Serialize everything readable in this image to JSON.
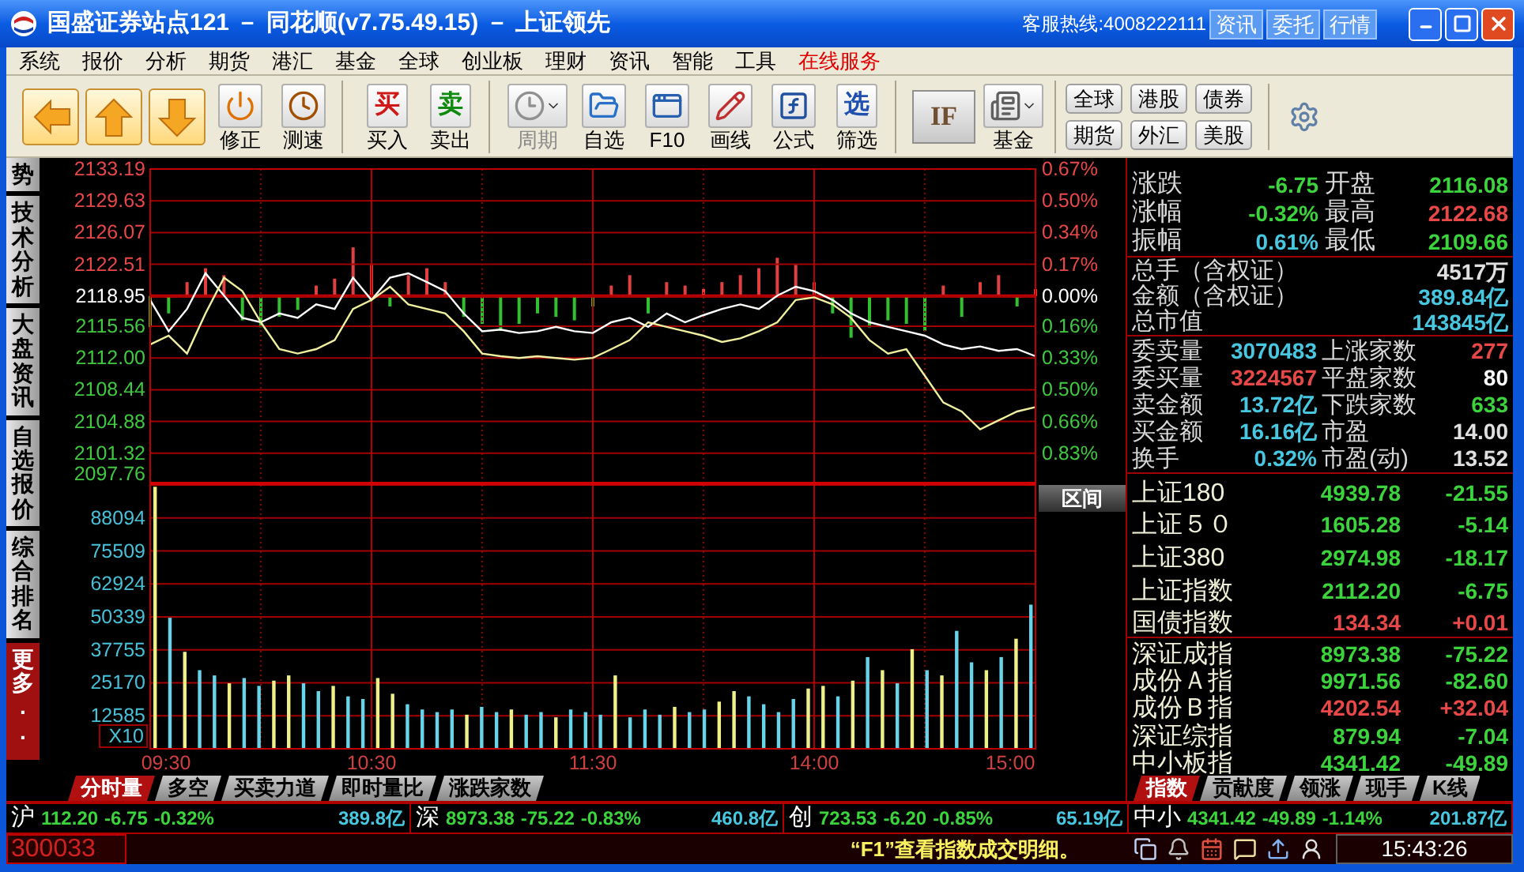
{
  "window": {
    "title": "国盛证券站点121 － 同花顺(v7.75.49.15) － 上证领先",
    "hotline": "客服热线:4008222111",
    "title_buttons": [
      "资讯",
      "委托",
      "行情"
    ]
  },
  "menu": [
    {
      "label": "系统",
      "kind": "normal"
    },
    {
      "label": "报价",
      "kind": "normal"
    },
    {
      "label": "分析",
      "kind": "normal"
    },
    {
      "label": "期货",
      "kind": "normal"
    },
    {
      "label": "港汇",
      "kind": "normal"
    },
    {
      "label": "基金",
      "kind": "normal"
    },
    {
      "label": "全球",
      "kind": "normal"
    },
    {
      "label": "创业板",
      "kind": "normal"
    },
    {
      "label": "理财",
      "kind": "normal"
    },
    {
      "label": "资讯",
      "kind": "normal"
    },
    {
      "label": "智能",
      "kind": "normal"
    },
    {
      "label": "工具",
      "kind": "normal"
    },
    {
      "label": "在线服务",
      "kind": "highlight"
    }
  ],
  "toolbar": {
    "groups": [
      {
        "items": [
          {
            "kind": "arrow"
          },
          {
            "kind": "arrow"
          },
          {
            "kind": "arrow"
          },
          {
            "kind": "tool",
            "label": "修正",
            "disabled": false,
            "dropdown": false
          },
          {
            "kind": "tool",
            "label": "测速",
            "disabled": false,
            "dropdown": false
          }
        ]
      },
      {
        "items": [
          {
            "kind": "glyph",
            "icon_text": "买",
            "color": "#d01818",
            "label": "买入",
            "disabled": false
          },
          {
            "kind": "glyph",
            "icon_text": "卖",
            "color": "#108a10",
            "label": "卖出",
            "disabled": false
          }
        ]
      },
      {
        "items": [
          {
            "kind": "tool",
            "label": "周期",
            "disabled": true,
            "dropdown": true
          },
          {
            "kind": "tool",
            "label": "自选",
            "disabled": false,
            "dropdown": false
          },
          {
            "kind": "tool",
            "label": "F10",
            "disabled": false,
            "dropdown": false
          },
          {
            "kind": "tool",
            "label": "画线",
            "disabled": false,
            "dropdown": false
          },
          {
            "kind": "tool",
            "label": "公式",
            "disabled": false,
            "dropdown": false
          },
          {
            "kind": "glyph",
            "icon_text": "选",
            "color": "#2050b0",
            "label": "筛选",
            "disabled": false
          }
        ]
      },
      {
        "items": [
          {
            "kind": "logo",
            "icon_text": "IF"
          },
          {
            "kind": "tool",
            "label": "基金",
            "disabled": false,
            "dropdown": true
          }
        ]
      }
    ],
    "quick_buttons": [
      "全球",
      "港股",
      "债券",
      "期货",
      "外汇",
      "美股"
    ]
  },
  "side_tabs": [
    {
      "label": "势",
      "kind": "tab"
    },
    {
      "label": "技术分析",
      "kind": "tab"
    },
    {
      "label": "大盘资讯",
      "kind": "tab"
    },
    {
      "label": "自选报价",
      "kind": "tab"
    },
    {
      "label": "综合排名",
      "kind": "tab"
    },
    {
      "label": "更多..",
      "kind": "more"
    }
  ],
  "chart": {
    "price": {
      "right_axis": [
        {
          "text": "0.67%",
          "color": "#e84848"
        },
        {
          "text": "0.50%",
          "color": "#e84848"
        },
        {
          "text": "0.34%",
          "color": "#e84848"
        },
        {
          "text": "0.17%",
          "color": "#e84848"
        },
        {
          "text": "0.00%",
          "color": "#ffffff"
        },
        {
          "text": "0.16%",
          "color": "#40c840"
        },
        {
          "text": "0.33%",
          "color": "#40c840"
        },
        {
          "text": "0.50%",
          "color": "#40c840"
        },
        {
          "text": "0.66%",
          "color": "#40c840"
        },
        {
          "text": "0.83%",
          "color": "#40c840"
        }
      ],
      "chart_data": {
        "type": "line",
        "grid": true,
        "ylim": [
          2097.76,
          2133.19
        ],
        "yticks": [
          {
            "value": 2133.19,
            "label": "2133.19"
          },
          {
            "value": 2129.63,
            "label": "2129.63"
          },
          {
            "value": 2126.07,
            "label": "2126.07"
          },
          {
            "value": 2122.51,
            "label": "2122.51"
          },
          {
            "value": 2118.95,
            "label": "2118.95"
          },
          {
            "value": 2115.56,
            "label": "2115.56"
          },
          {
            "value": 2112.0,
            "label": "2112.00"
          },
          {
            "value": 2108.44,
            "label": "2108.44"
          },
          {
            "value": 2104.88,
            "label": "2104.88"
          },
          {
            "value": 2101.32,
            "label": "2101.32"
          },
          {
            "value": 2097.76,
            "label": "2097.76"
          }
        ],
        "series": [
          {
            "color": "#ffffff",
            "values": [
              2118.5,
              2115.0,
              2117.5,
              2121.5,
              2119.0,
              2116.5,
              2116.0,
              2117.0,
              2116.5,
              2118.0,
              2117.5,
              2121.0,
              2118.5,
              2121.0,
              2121.5,
              2120.5,
              2119.5,
              2117.0,
              2115.0,
              2115.2,
              2114.8,
              2115.0,
              2115.5,
              2115.0,
              2114.8,
              2116.0,
              2116.5,
              2115.5,
              2117.0,
              2116.0,
              2116.8,
              2117.5,
              2118.0,
              2117.5,
              2119.0,
              2120.0,
              2119.5,
              2118.5,
              2117.0,
              2116.0,
              2115.5,
              2115.0,
              2114.5,
              2113.5,
              2113.0,
              2113.3,
              2112.8,
              2113.0,
              2112.2
            ]
          },
          {
            "color": "#f0f0a0",
            "values": [
              2113.5,
              2114.5,
              2112.5,
              2117.0,
              2121.0,
              2119.5,
              2116.0,
              2113.0,
              2112.5,
              2113.0,
              2114.0,
              2117.5,
              2118.5,
              2120.0,
              2118.0,
              2117.5,
              2117.0,
              2115.0,
              2112.5,
              2112.2,
              2112.0,
              2112.2,
              2112.0,
              2111.8,
              2112.0,
              2113.0,
              2114.0,
              2116.0,
              2115.5,
              2115.0,
              2114.5,
              2113.8,
              2114.2,
              2115.0,
              2116.0,
              2118.5,
              2118.8,
              2118.0,
              2116.5,
              2114.0,
              2112.5,
              2113.0,
              2110.0,
              2107.0,
              2106.0,
              2104.0,
              2105.0,
              2106.0,
              2106.5
            ]
          }
        ]
      }
    },
    "range_button": "区间",
    "volume": {
      "multiplier": "X10",
      "chart_data": {
        "type": "bar",
        "grid": true,
        "ylim": [
          0,
          100679
        ],
        "yticks": [
          12585,
          25170,
          37755,
          50339,
          62924,
          75509,
          88094
        ],
        "series": [
          {
            "color": "#f0f088",
            "values": [
              100000,
              null,
              37000,
              null,
              null,
              25000,
              null,
              null,
              26000,
              28000,
              null,
              null,
              24000,
              null,
              null,
              27000,
              21000,
              null,
              null,
              null,
              null,
              13000,
              null,
              null,
              15000,
              null,
              null,
              12000,
              null,
              null,
              null,
              28000,
              null,
              null,
              null,
              16000,
              null,
              null,
              18000,
              22000,
              null,
              null,
              null,
              null,
              23000,
              24000,
              null,
              26000,
              null,
              30000,
              null,
              38000,
              null,
              28000,
              null,
              null,
              30000,
              null,
              42000,
              null
            ]
          },
          {
            "color": "#68d4ea",
            "values": [
              null,
              50000,
              null,
              30000,
              28000,
              null,
              27000,
              24000,
              null,
              null,
              25000,
              22000,
              null,
              20000,
              19000,
              null,
              null,
              17000,
              15000,
              14000,
              15000,
              null,
              16000,
              14000,
              null,
              13000,
              14000,
              null,
              15000,
              14000,
              13000,
              null,
              12000,
              15000,
              13000,
              null,
              14000,
              15000,
              null,
              null,
              20000,
              17000,
              14000,
              19000,
              null,
              null,
              20000,
              null,
              35000,
              null,
              25000,
              null,
              30000,
              null,
              45000,
              33000,
              null,
              35000,
              null,
              55000
            ]
          }
        ]
      }
    },
    "time_axis": [
      "09:30",
      "10:30",
      "11:30",
      "14:00",
      "15:00"
    ],
    "tabs": [
      {
        "label": "分时量",
        "selected": true
      },
      {
        "label": "多空",
        "selected": false
      },
      {
        "label": "买卖力道",
        "selected": false
      },
      {
        "label": "即时量比",
        "selected": false
      },
      {
        "label": "涨跌家数",
        "selected": false
      }
    ]
  },
  "quote": [
    {
      "label": "涨跌",
      "value": "-6.75",
      "color": "#3cd43c"
    },
    {
      "label": "开盘",
      "value": "2116.08",
      "color": "#3cd43c"
    },
    {
      "label": "涨幅",
      "value": "-0.32%",
      "color": "#3cd43c"
    },
    {
      "label": "最高",
      "value": "2122.68",
      "color": "#e84848"
    },
    {
      "label": "振幅",
      "value": "0.61%",
      "color": "#48c8e0"
    },
    {
      "label": "最低",
      "value": "2109.66",
      "color": "#3cd43c"
    }
  ],
  "totals": [
    {
      "label": "总手（含权证）",
      "value": "4517万",
      "color": "#e0e0e0"
    },
    {
      "label": "金额（含权证）",
      "value": "389.84亿",
      "color": "#48c8e0"
    },
    {
      "label": "总市值",
      "value": "143845亿",
      "color": "#48c8e0"
    }
  ],
  "market_stats": [
    {
      "label": "委卖量",
      "value": "3070483",
      "color": "#48c8e0"
    },
    {
      "label": "上涨家数",
      "value": "277",
      "color": "#e84848"
    },
    {
      "label": "委买量",
      "value": "3224567",
      "color": "#e84848"
    },
    {
      "label": "平盘家数",
      "value": "80",
      "color": "#ffffff"
    },
    {
      "label": "卖金额",
      "value": "13.72亿",
      "color": "#48c8e0"
    },
    {
      "label": "下跌家数",
      "value": "633",
      "color": "#3cd43c"
    },
    {
      "label": "买金额",
      "value": "16.16亿",
      "color": "#48c8e0"
    },
    {
      "label": "市盈",
      "value": "14.00",
      "color": "#e0e0e0"
    },
    {
      "label": "换手",
      "value": "0.32%",
      "color": "#48c8e0"
    },
    {
      "label": "市盈(动)",
      "value": "13.52",
      "color": "#e0e0e0"
    }
  ],
  "indices_sh": [
    {
      "name": "上证180",
      "value": "4939.78",
      "change": "-21.55",
      "color": "#3cd43c"
    },
    {
      "name": "上证５０",
      "value": "1605.28",
      "change": "-5.14",
      "color": "#3cd43c"
    },
    {
      "name": "上证380",
      "value": "2974.98",
      "change": "-18.17",
      "color": "#3cd43c"
    },
    {
      "name": "上证指数",
      "value": "2112.20",
      "change": "-6.75",
      "color": "#3cd43c"
    },
    {
      "name": "国债指数",
      "value": "134.34",
      "change": "+0.01",
      "color": "#e84848"
    }
  ],
  "indices_sz": [
    {
      "name": "深证成指",
      "value": "8973.38",
      "change": "-75.22",
      "color": "#3cd43c"
    },
    {
      "name": "成份Ａ指",
      "value": "9971.56",
      "change": "-82.60",
      "color": "#3cd43c"
    },
    {
      "name": "成份Ｂ指",
      "value": "4202.54",
      "change": "+32.04",
      "color": "#e84848"
    },
    {
      "name": "深证综指",
      "value": "879.94",
      "change": "-7.04",
      "color": "#3cd43c"
    },
    {
      "name": "中小板指",
      "value": "4341.42",
      "change": "-49.89",
      "color": "#3cd43c"
    }
  ],
  "panel_tabs": [
    {
      "label": "指数",
      "selected": true
    },
    {
      "label": "贡献度",
      "selected": false
    },
    {
      "label": "领涨",
      "selected": false
    },
    {
      "label": "现手",
      "selected": false
    },
    {
      "label": "K线",
      "selected": false
    }
  ],
  "ticker": [
    {
      "market": "沪",
      "price": "112.20",
      "change": "-6.75",
      "pct": "-0.32%",
      "amount": "389.8亿"
    },
    {
      "market": "深",
      "price": "8973.38",
      "change": "-75.22",
      "pct": "-0.83%",
      "amount": "460.8亿"
    },
    {
      "market": "创",
      "price": "723.53",
      "change": "-6.20",
      "pct": "-0.85%",
      "amount": "65.19亿"
    },
    {
      "market": "中小",
      "price": "4341.42",
      "change": "-49.89",
      "pct": "-1.14%",
      "amount": "201.87亿"
    }
  ],
  "status_bar": {
    "code": "300033",
    "message": "“F1”查看指数成交明细。",
    "time": "15:43:26"
  }
}
